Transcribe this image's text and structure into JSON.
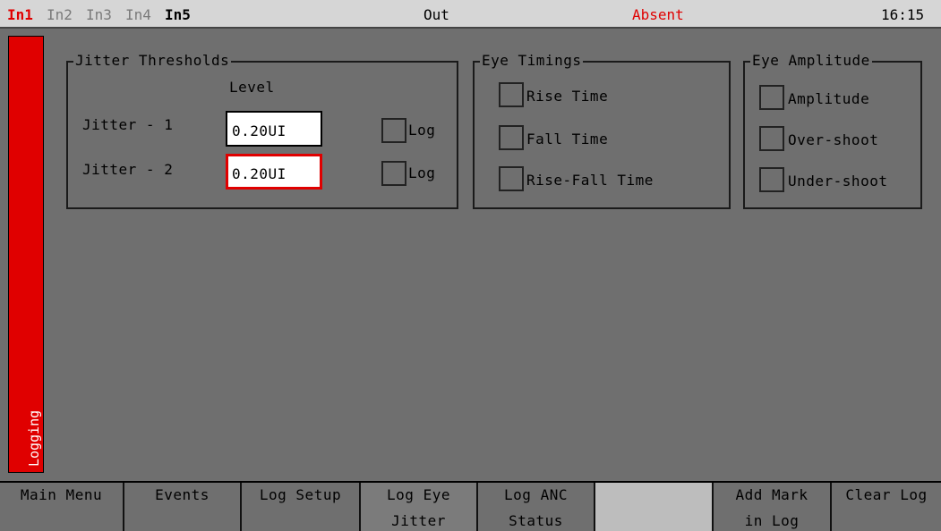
{
  "topbar": {
    "inputs": [
      "In1",
      "In2",
      "In3",
      "In4",
      "In5"
    ],
    "output_label": "Out",
    "status": "Absent",
    "clock": "16:15"
  },
  "side_tab": {
    "label": "Logging"
  },
  "jitter_thresholds": {
    "title": "Jitter Thresholds",
    "level_header": "Level",
    "rows": [
      {
        "label": "Jitter - 1",
        "value": "0.20UI",
        "log_label": "Log",
        "log_checked": false
      },
      {
        "label": "Jitter - 2",
        "value": "0.20UI",
        "log_label": "Log",
        "log_checked": false
      }
    ]
  },
  "eye_timings": {
    "title": "Eye Timings",
    "items": [
      {
        "label": "Rise Time",
        "checked": false
      },
      {
        "label": "Fall Time",
        "checked": false
      },
      {
        "label": "Rise-Fall Time",
        "checked": false
      }
    ]
  },
  "eye_amplitude": {
    "title": "Eye Amplitude",
    "items": [
      {
        "label": "Amplitude",
        "checked": false
      },
      {
        "label": "Over-shoot",
        "checked": false
      },
      {
        "label": "Under-shoot",
        "checked": false
      }
    ]
  },
  "softkeys": [
    {
      "line1": "Main Menu",
      "line2": ""
    },
    {
      "line1": "Events",
      "line2": ""
    },
    {
      "line1": "Log Setup",
      "line2": ""
    },
    {
      "line1": "Log Eye",
      "line2": "Jitter"
    },
    {
      "line1": "Log ANC",
      "line2": "Status"
    },
    {
      "line1": "",
      "line2": ""
    },
    {
      "line1": "Add Mark",
      "line2": "in Log"
    },
    {
      "line1": "Clear Log",
      "line2": ""
    }
  ],
  "colors": {
    "background": "#6f6f6f",
    "topbar": "#d6d6d6",
    "accent_red": "#e00000",
    "blank_key": "#bdbdbd"
  }
}
